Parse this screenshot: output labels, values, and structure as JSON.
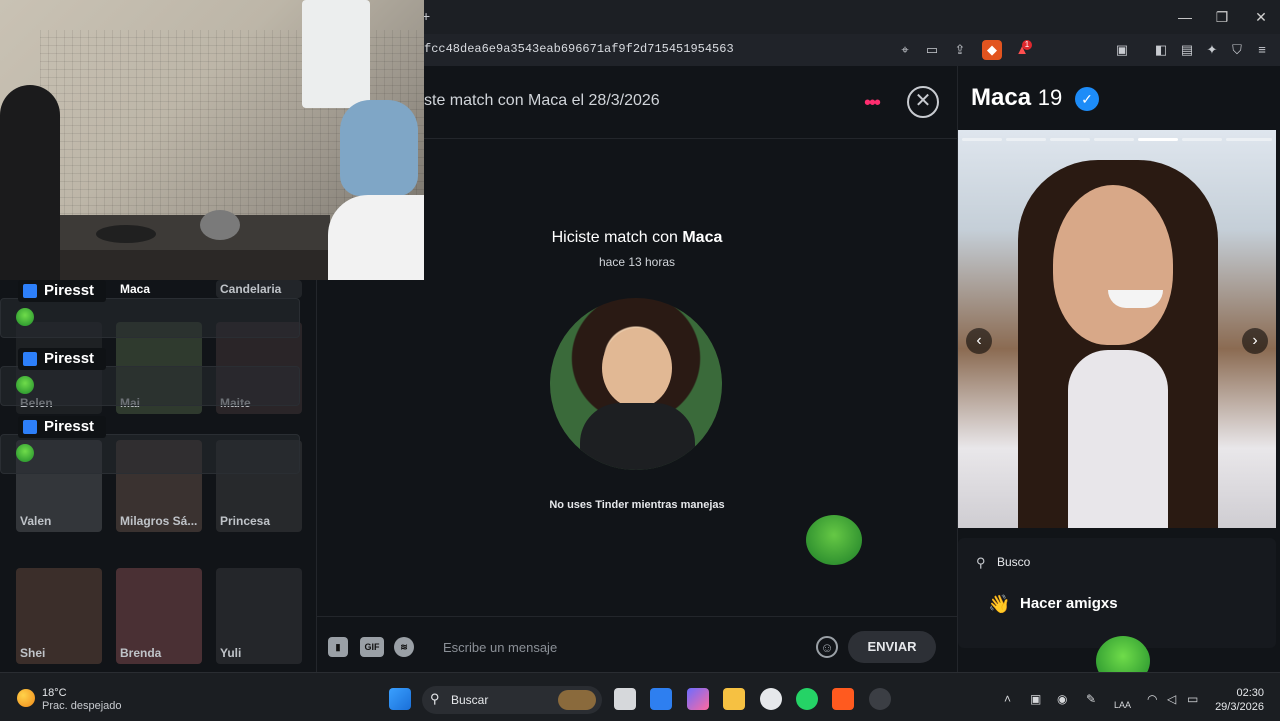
{
  "browser": {
    "url": "fcc48dea6e9a3543eab696671af9f2d715451954563",
    "new_tab": "+",
    "window": {
      "minimize": "—",
      "restore": "❐",
      "close": "✕"
    },
    "extension_badge": "1"
  },
  "sidebar": {
    "overlay_label": "Piresst",
    "matches": [
      {
        "name": "Maca"
      },
      {
        "name": "Candelaria"
      },
      {
        "name": "Belen"
      },
      {
        "name": "Mai"
      },
      {
        "name": "Maite"
      },
      {
        "name": "Valen"
      },
      {
        "name": "Milagros Sá..."
      },
      {
        "name": "Princesa"
      },
      {
        "name": "Shei"
      },
      {
        "name": "Brenda"
      },
      {
        "name": "Yuli"
      }
    ]
  },
  "chat": {
    "header_title": "ste match con Maca el 28/3/2026",
    "more_icon": "•••",
    "close_icon": "✕",
    "match_intro": "Hiciste match con ",
    "match_name": "Maca",
    "match_time": "hace 13 horas",
    "safety_notice": "No uses Tinder mientras manejas",
    "input_placeholder": "Escribe un mensaje",
    "send_label": "ENVIAR",
    "gif_label": "GIF"
  },
  "profile": {
    "name": "Maca",
    "age": "19",
    "verified_icon": "✓",
    "looking_for_label": "Busco",
    "looking_for_value": "Hacer amigxs",
    "looking_for_emoji": "👋",
    "photo_prev": "‹",
    "photo_next": "›"
  },
  "taskbar": {
    "weather_temp": "18°C",
    "weather_desc": "Prac. despejado",
    "search_label": "Buscar",
    "time": "02:30",
    "date": "29/3/2026",
    "lang": "LAA"
  },
  "colors": {
    "accent_pink": "#ff2d6f",
    "verified_blue": "#1d8cf8",
    "bg": "#111418"
  }
}
